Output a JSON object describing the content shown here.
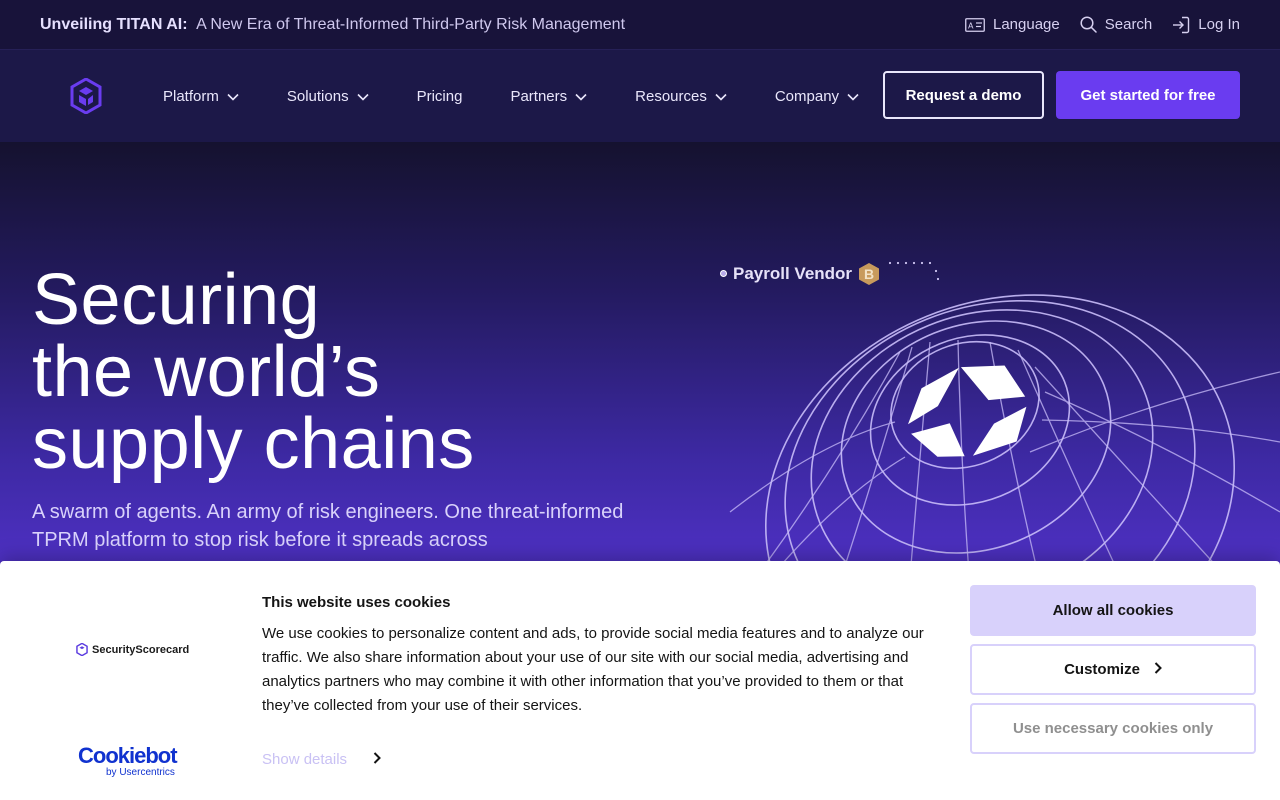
{
  "announcement": {
    "highlight": "Unveiling TITAN AI:",
    "text": "A New Era of Threat-Informed Third-Party Risk Management"
  },
  "utility_nav": {
    "language": "Language",
    "search": "Search",
    "login": "Log In"
  },
  "nav": {
    "items": [
      {
        "label": "Platform",
        "has_dropdown": true
      },
      {
        "label": "Solutions",
        "has_dropdown": true
      },
      {
        "label": "Pricing",
        "has_dropdown": false
      },
      {
        "label": "Partners",
        "has_dropdown": true
      },
      {
        "label": "Resources",
        "has_dropdown": true
      },
      {
        "label": "Company",
        "has_dropdown": true
      }
    ],
    "demo_button": "Request a demo",
    "start_button": "Get started for free"
  },
  "hero": {
    "title_lines": [
      "Securing",
      "the world’s",
      "supply chains"
    ],
    "subtitle": "A swarm of agents. An army of risk engineers. One threat-informed TPRM platform to stop risk before it spreads across",
    "vendor_label": "Payroll Vendor",
    "vendor_grade": "B"
  },
  "cookie_banner": {
    "brand": "SecurityScorecard",
    "cookiebot_main": "Cookiebot",
    "cookiebot_sub": "by Usercentrics",
    "title": "This website uses cookies",
    "body": "We use cookies to personalize content and ads, to provide social media features and to analyze our traffic. We also share information about your use of our site with our social media, advertising and analytics partners who may combine it with other information that you’ve provided to them or that they’ve collected from your use of their services.",
    "show_details": "Show details",
    "allow_all": "Allow all cookies",
    "customize": "Customize",
    "necessary_only": "Use necessary cookies only"
  },
  "colors": {
    "accent": "#6a3cf0",
    "nav_bg": "#1c1848",
    "announce_bg": "#18133a",
    "cookie_button": "#d8d1fb",
    "vendor_badge": "#c89a5c"
  }
}
